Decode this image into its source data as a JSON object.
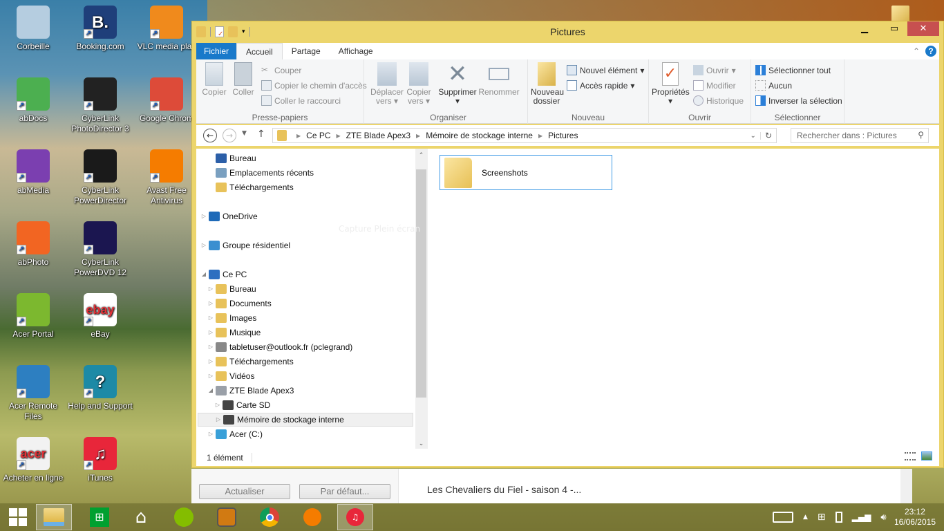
{
  "desktop": {
    "icons": [
      {
        "label": "Corbeille",
        "icon": "recycle-bin-icon",
        "color": "#b5cde0"
      },
      {
        "label": "Booking.com",
        "icon": "booking-icon",
        "color": "#1f3f7a",
        "glyph": "B."
      },
      {
        "label": "VLC media play",
        "icon": "vlc-icon",
        "color": "#f08a1c"
      },
      {
        "label": "abDocs",
        "icon": "abdocs-icon",
        "color": "#4caf50"
      },
      {
        "label": "CyberLink PhotoDirector 3",
        "icon": "photodirector-icon",
        "color": "#222222"
      },
      {
        "label": "Google Chrom",
        "icon": "chrome-icon",
        "color": "#dd4b39"
      },
      {
        "label": "abMedia",
        "icon": "abmedia-icon",
        "color": "#7b3fb0"
      },
      {
        "label": "CyberLink PowerDirector",
        "icon": "powerdirector-icon",
        "color": "#1a1a1a"
      },
      {
        "label": "Avast Free Antivirus",
        "icon": "avast-icon",
        "color": "#f57c00"
      },
      {
        "label": "abPhoto",
        "icon": "abphoto-icon",
        "color": "#f26522"
      },
      {
        "label": "CyberLink PowerDVD 12",
        "icon": "powerdvd-icon",
        "color": "#1b1650"
      },
      {
        "label": "Acer Portal",
        "icon": "acer-portal-icon",
        "color": "#7cb82f"
      },
      {
        "label": "eBay",
        "icon": "ebay-icon",
        "color": "#ffffff",
        "glyph": "ebay"
      },
      {
        "label": "Acer Remote Files",
        "icon": "acer-remote-files-icon",
        "color": "#2d7fc1"
      },
      {
        "label": "Help and Support",
        "icon": "help-icon",
        "color": "#1d8aa6",
        "glyph": "?"
      },
      {
        "label": "Acheter en ligne",
        "icon": "acer-store-icon",
        "color": "#f2f2f2",
        "glyph": "acer"
      },
      {
        "label": "iTunes",
        "icon": "itunes-icon",
        "color": "#e8263a",
        "glyph": "♫"
      }
    ],
    "context_tooltip": "Capture Plein écran"
  },
  "window": {
    "title": "Pictures",
    "tabs": [
      "Fichier",
      "Accueil",
      "Partage",
      "Affichage"
    ],
    "active_tab": "Accueil",
    "ribbon": {
      "clipboard": {
        "label": "Presse-papiers",
        "copy": "Copier",
        "paste": "Coller",
        "cut": "Couper",
        "copy_path": "Copier le chemin d'accès",
        "paste_shortcut": "Coller le raccourci"
      },
      "organize": {
        "label": "Organiser",
        "move_to": "Déplacer",
        "move_to2": "vers",
        "copy_to": "Copier",
        "copy_to2": "vers",
        "delete": "Supprimer",
        "rename": "Renommer"
      },
      "new": {
        "label": "Nouveau",
        "new_folder": "Nouveau",
        "new_folder2": "dossier",
        "new_item": "Nouvel élément",
        "easy_access": "Accès rapide"
      },
      "open": {
        "label": "Ouvrir",
        "properties": "Propriétés",
        "open": "Ouvrir",
        "edit": "Modifier",
        "history": "Historique"
      },
      "select": {
        "label": "Sélectionner",
        "select_all": "Sélectionner tout",
        "select_none": "Aucun",
        "invert": "Inverser la sélection"
      }
    },
    "breadcrumb": [
      "Ce PC",
      "ZTE Blade Apex3",
      "Mémoire de stockage interne",
      "Pictures"
    ],
    "search_placeholder": "Rechercher dans : Pictures",
    "nav_tree": [
      {
        "label": "Bureau",
        "level": 1,
        "expander": "",
        "icon": "desktop-icon",
        "color": "#2c5fa8"
      },
      {
        "label": "Emplacements récents",
        "level": 1,
        "expander": "",
        "icon": "recent-places-icon",
        "color": "#7aa0c0"
      },
      {
        "label": "Téléchargements",
        "level": 1,
        "expander": "",
        "icon": "downloads-icon",
        "color": "#e8c25a"
      },
      {
        "label": "OneDrive",
        "level": 0,
        "expander": "▷",
        "icon": "onedrive-icon",
        "color": "#1e6ab8"
      },
      {
        "label": "Groupe résidentiel",
        "level": 0,
        "expander": "▷",
        "icon": "homegroup-icon",
        "color": "#3a8fd0"
      },
      {
        "label": "Ce PC",
        "level": 0,
        "expander": "◢",
        "icon": "computer-icon",
        "color": "#2d6fc0"
      },
      {
        "label": "Bureau",
        "level": 1,
        "expander": "▷",
        "icon": "desktop-folder-icon",
        "color": "#e8c25a"
      },
      {
        "label": "Documents",
        "level": 1,
        "expander": "▷",
        "icon": "documents-icon",
        "color": "#e8c25a"
      },
      {
        "label": "Images",
        "level": 1,
        "expander": "▷",
        "icon": "pictures-icon",
        "color": "#e8c25a"
      },
      {
        "label": "Musique",
        "level": 1,
        "expander": "▷",
        "icon": "music-icon",
        "color": "#e8c25a"
      },
      {
        "label": "tabletuser@outlook.fr (pclegrand)",
        "level": 1,
        "expander": "▷",
        "icon": "network-drive-icon",
        "color": "#888888"
      },
      {
        "label": "Téléchargements",
        "level": 1,
        "expander": "▷",
        "icon": "downloads-folder-icon",
        "color": "#e8c25a"
      },
      {
        "label": "Vidéos",
        "level": 1,
        "expander": "▷",
        "icon": "videos-icon",
        "color": "#e8c25a"
      },
      {
        "label": "ZTE Blade Apex3",
        "level": 1,
        "expander": "◢",
        "icon": "phone-icon",
        "color": "#9aa0a8"
      },
      {
        "label": "Carte SD",
        "level": 2,
        "expander": "▷",
        "icon": "drive-icon",
        "color": "#444444"
      },
      {
        "label": "Mémoire de stockage interne",
        "level": 2,
        "expander": "▷",
        "icon": "drive-icon",
        "color": "#444444",
        "selected": true
      },
      {
        "label": "Acer (C:)",
        "level": 1,
        "expander": "▷",
        "icon": "system-drive-icon",
        "color": "#3aa0d8"
      }
    ],
    "items": [
      {
        "name": "Screenshots",
        "type": "folder"
      }
    ],
    "status": "1 élément"
  },
  "background_app": {
    "refresh_button": "Actualiser",
    "default_button": "Par défaut...",
    "list_item_title": "Les Chevaliers du Fiel - saison 4 -..."
  },
  "taskbar": {
    "apps": [
      "start-icon",
      "file-explorer-icon",
      "store-icon",
      "home-icon",
      "spotify-icon",
      "notes-icon",
      "chrome-icon",
      "avast-icon",
      "itunes-icon"
    ],
    "time": "23:12",
    "date": "16/06/2015"
  },
  "colors": {
    "accent": "#1979ca",
    "window_frame": "#ecd56c",
    "close": "#c75050",
    "selection": "#3f9ae5"
  }
}
